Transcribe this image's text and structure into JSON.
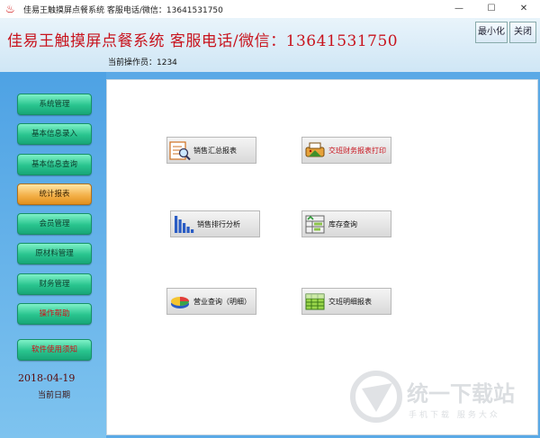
{
  "window": {
    "title": "佳易王触摸屏点餐系统 客服电话/微信：13641531750",
    "minimize_glyph": "—",
    "maximize_glyph": "☐",
    "close_glyph": "✕"
  },
  "header": {
    "app_title": "佳易王触摸屏点餐系统  客服电话/微信：13641531750",
    "operator": "当前操作员：1234",
    "minimize_label": "最小化",
    "close_label": "关闭"
  },
  "sidebar": {
    "items": [
      {
        "label": "系统管理"
      },
      {
        "label": "基本信息录入"
      },
      {
        "label": "基本信息查询"
      },
      {
        "label": "统计报表"
      },
      {
        "label": "会员管理"
      },
      {
        "label": "原材料管理"
      },
      {
        "label": "财务管理"
      },
      {
        "label": "操作帮助"
      },
      {
        "label": "软件使用须知"
      }
    ],
    "active_index": 3,
    "date": "2018-04-19",
    "date_label": "当前日期"
  },
  "functions": [
    {
      "label": "销售汇总报表",
      "icon": "sales-summary-icon"
    },
    {
      "label": "交班财务报表打印",
      "icon": "shift-finance-print-icon"
    },
    {
      "label": "销售排行分析",
      "icon": "bar-chart-icon"
    },
    {
      "label": "库存查询",
      "icon": "inventory-icon"
    },
    {
      "label": "营业查询（明细）",
      "icon": "pie-chart-icon"
    },
    {
      "label": "交班明细报表",
      "icon": "grid-report-icon"
    }
  ],
  "watermark": {
    "text": "统一下载站",
    "subtext": "手机下载  服务大众"
  },
  "colors": {
    "title_red": "#c8141e",
    "nav_green": "#29c48e",
    "nav_active": "#f4b14a"
  }
}
